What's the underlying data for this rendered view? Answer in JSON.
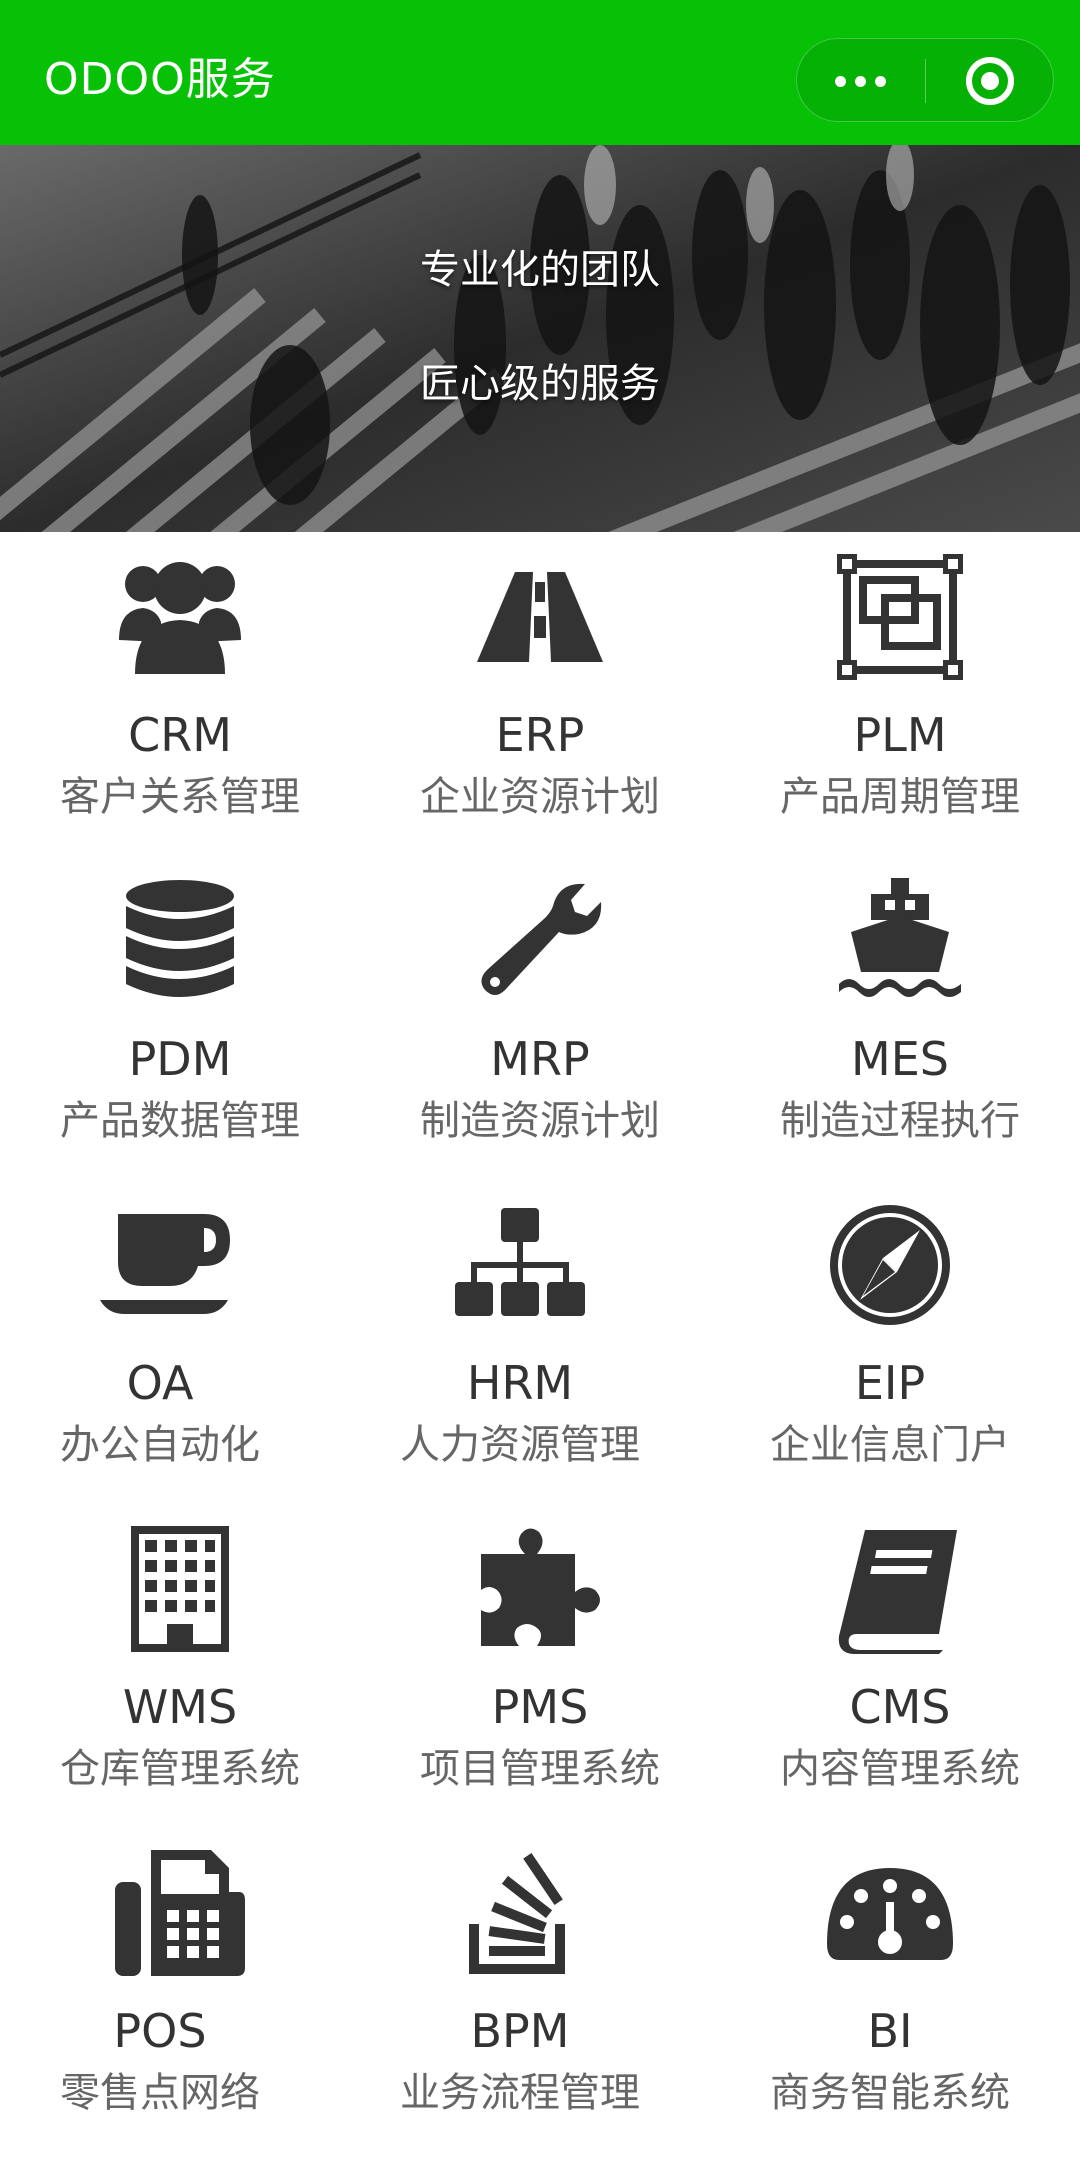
{
  "titlebar": {
    "title": "ODOO服务",
    "more_icon": "more-dots-icon",
    "close_icon": "target-close-icon",
    "background": "#07c107"
  },
  "banner": {
    "line1": "专业化的团队",
    "line2": "匠心级的服务"
  },
  "services": [
    {
      "code": "CRM",
      "desc": "客户关系管理",
      "icon": "users-icon"
    },
    {
      "code": "ERP",
      "desc": "企业资源计划",
      "icon": "road-icon"
    },
    {
      "code": "PLM",
      "desc": "产品周期管理",
      "icon": "object-group-icon"
    },
    {
      "code": "PDM",
      "desc": "产品数据管理",
      "icon": "database-icon"
    },
    {
      "code": "MRP",
      "desc": "制造资源计划",
      "icon": "wrench-icon"
    },
    {
      "code": "MES",
      "desc": "制造过程执行",
      "icon": "ship-icon"
    },
    {
      "code": "OA",
      "desc": "办公自动化",
      "icon": "coffee-icon"
    },
    {
      "code": "HRM",
      "desc": "人力资源管理",
      "icon": "sitemap-icon"
    },
    {
      "code": "EIP",
      "desc": "企业信息门户",
      "icon": "compass-icon"
    },
    {
      "code": "WMS",
      "desc": "仓库管理系统",
      "icon": "building-icon"
    },
    {
      "code": "PMS",
      "desc": "项目管理系统",
      "icon": "puzzle-icon"
    },
    {
      "code": "CMS",
      "desc": "内容管理系统",
      "icon": "book-icon"
    },
    {
      "code": "POS",
      "desc": "零售点网络",
      "icon": "fax-icon"
    },
    {
      "code": "BPM",
      "desc": "业务流程管理",
      "icon": "stack-overflow-icon"
    },
    {
      "code": "BI",
      "desc": "商务智能系统",
      "icon": "dashboard-icon"
    }
  ],
  "colors": {
    "icon": "#333333",
    "code_text": "#333333",
    "desc_text": "#666666"
  }
}
